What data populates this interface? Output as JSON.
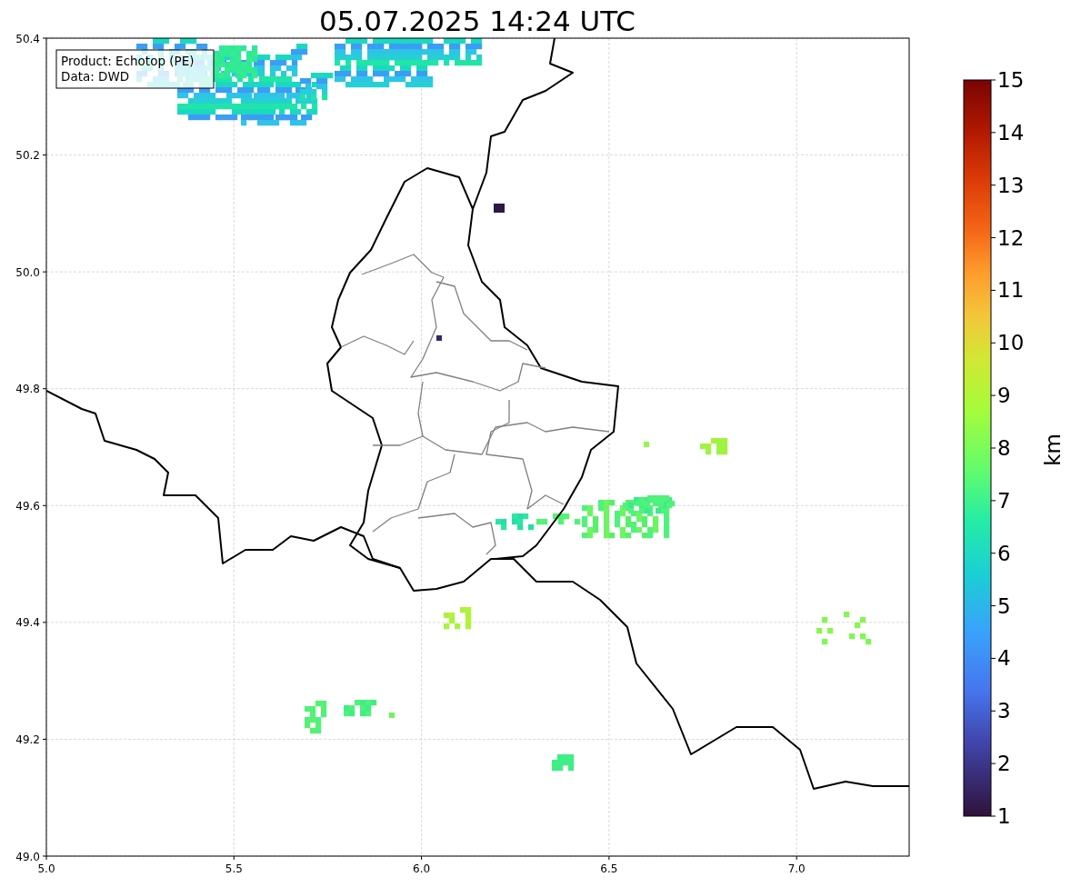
{
  "title": "05.07.2025 14:24 UTC",
  "legend": [
    "Product: Echotop (PE)",
    "Data: DWD"
  ],
  "map": {
    "y_ticks": [
      "50.4",
      "50.2",
      "50.0",
      "49.8",
      "49.6",
      "49.4",
      "49.2",
      "49.0"
    ],
    "x_ticks": [
      "5.0",
      "5.5",
      "6.0",
      "6.5",
      "7.0"
    ]
  },
  "colorbar": {
    "ticks": [
      "15",
      "14",
      "13",
      "12",
      "11",
      "10",
      "9",
      "8",
      "7",
      "6",
      "5",
      "4",
      "3",
      "2",
      "1"
    ],
    "label": "km"
  }
}
